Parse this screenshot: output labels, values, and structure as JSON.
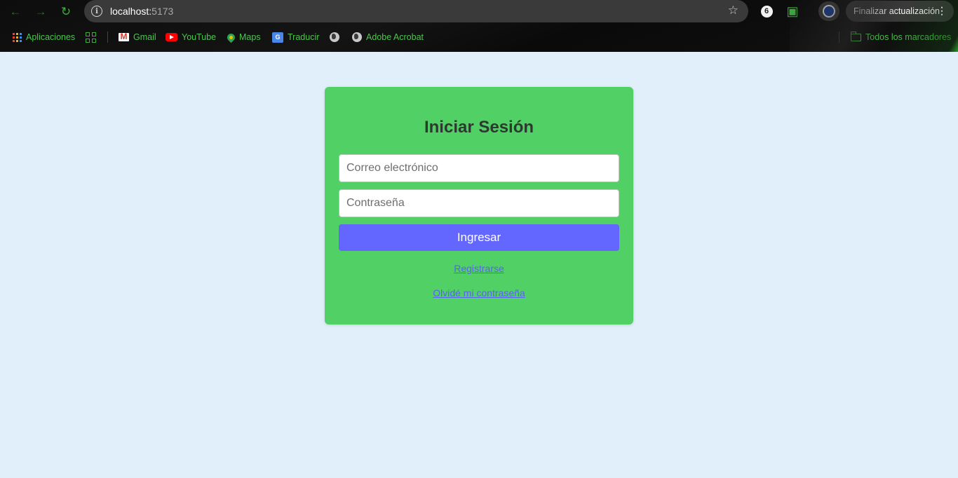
{
  "browser": {
    "url_host": "localhost:",
    "url_port": "5173",
    "update_button": "Finalizar actualización",
    "ext_badge": "6",
    "bookmarks": [
      {
        "label": "Aplicaciones",
        "icon": "apps-launcher-icon"
      },
      {
        "label": "",
        "icon": "tab-groups-icon"
      },
      {
        "label": "Gmail",
        "icon": "gmail-icon"
      },
      {
        "label": "YouTube",
        "icon": "youtube-icon"
      },
      {
        "label": "Maps",
        "icon": "maps-icon"
      },
      {
        "label": "Traducir",
        "icon": "translate-icon"
      },
      {
        "label": "",
        "icon": "globe-icon"
      },
      {
        "label": "Adobe Acrobat",
        "icon": "globe-icon"
      }
    ],
    "all_bookmarks": "Todos los marcadores",
    "accent_color": "#4fc44f"
  },
  "login": {
    "title": "Iniciar Sesión",
    "email_placeholder": "Correo electrónico",
    "password_placeholder": "Contraseña",
    "submit_label": "Ingresar",
    "register_link": "Registrarse",
    "forgot_link": "Olvidé mi contraseña",
    "card_color": "#50d065",
    "button_color": "#6366ff",
    "background_color": "#e0effa"
  }
}
